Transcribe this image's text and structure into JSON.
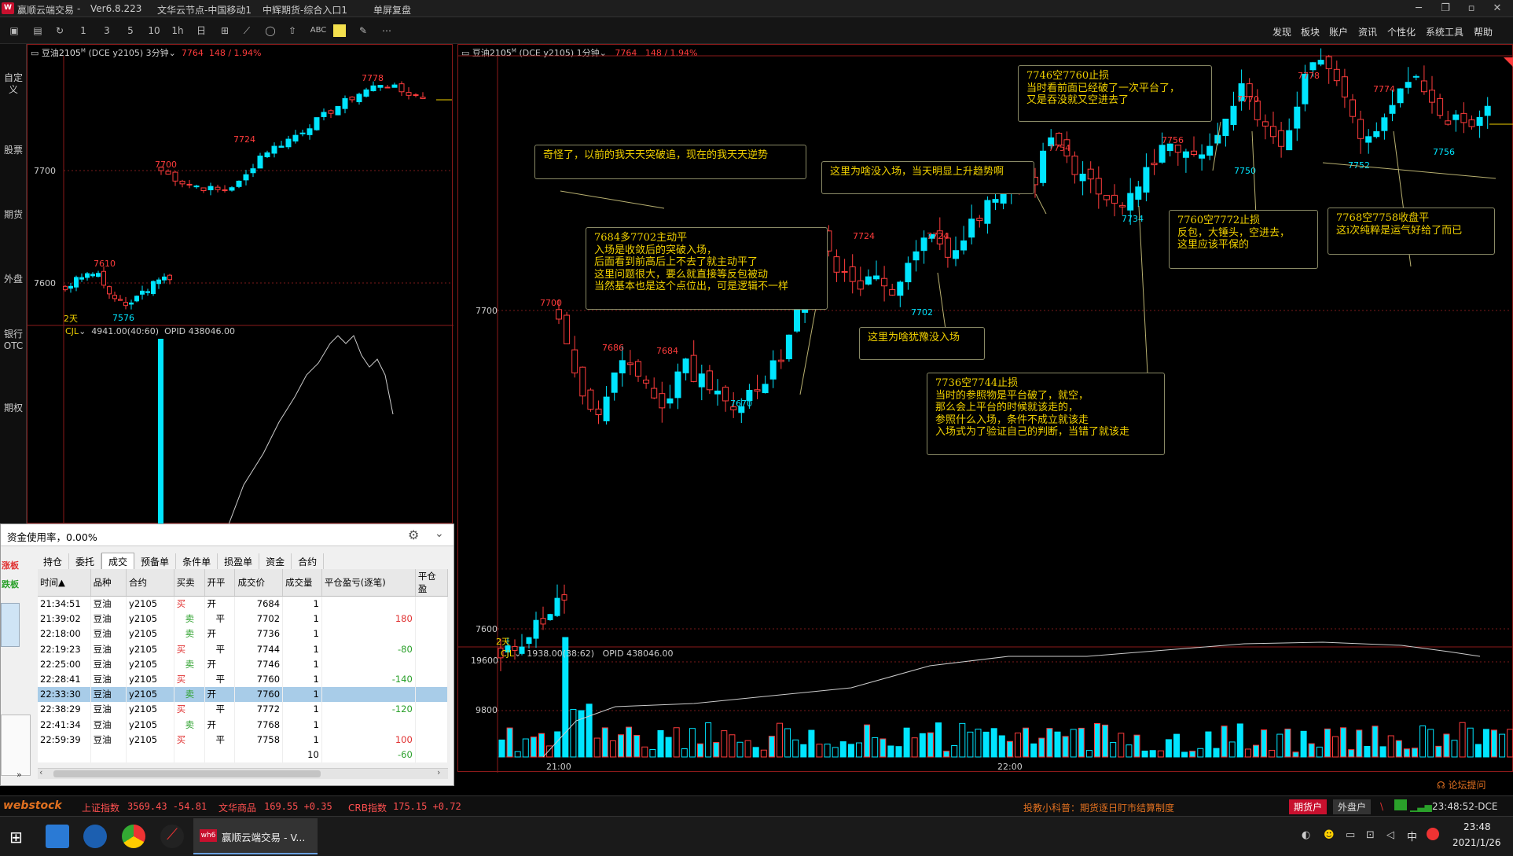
{
  "app": {
    "title": "赢顺云端交易",
    "version": "Ver6.8.223",
    "node": "文华云节点-中国移动1",
    "broker": "中辉期货-综合入口1",
    "mode": "单屏复盘",
    "win_controls": [
      "─",
      "❐",
      "▫",
      "✕"
    ]
  },
  "toolbar": {
    "periods": [
      "1",
      "3",
      "5",
      "10",
      "1h",
      "日"
    ],
    "menus": [
      "发现",
      "板块",
      "账户",
      "资讯",
      "个性化",
      "系统工具",
      "帮助"
    ]
  },
  "sidetabs": [
    "自定义",
    "股票",
    "期货",
    "外盘",
    "银行OTC",
    "期权"
  ],
  "left_chart": {
    "symbol": "豆油2105",
    "sup": "M",
    "code": "(DCE y2105)",
    "period": "3分钟",
    "price": "7764",
    "change": "148 / 1.94%",
    "y_labels": [
      "7700",
      "7600"
    ],
    "marks": [
      "7778",
      "7724",
      "7700",
      "7610",
      "7576"
    ],
    "days": "2天",
    "vol_label": "CJL",
    "vol_value": "4941.00(40:60)",
    "opi": "OPID 438046.00"
  },
  "main_chart": {
    "symbol": "豆油2105",
    "sup": "M",
    "code": "(DCE y2105)",
    "period": "1分钟",
    "price": "7764",
    "change": "148 / 1.94%",
    "y_labels": [
      "7700",
      "7600"
    ],
    "marks": [
      "7700",
      "7686",
      "7684",
      "7670",
      "7724",
      "7724",
      "7702",
      "7754",
      "7734",
      "7756",
      "7770",
      "7750",
      "7778",
      "7752",
      "7774",
      "7756"
    ],
    "days": "2天",
    "vol_label": "CJL",
    "vol_value": "1938.00(38:62)",
    "opi": "OPID 438046.00",
    "vol_y": [
      "19600",
      "9800"
    ],
    "x_labels": [
      "21:00",
      "22:00"
    ]
  },
  "notes": [
    "奇怪了，以前的我天天突破追，现在的我天天逆势",
    "7684多7702主动平\n入场是收敛后的突破入场，\n后面看到前高后上不去了就主动平了\n这里问题很大，要么就直接等反包被动\n当然基本也是这个点位出，可是逻辑不一样",
    "这里为啥没入场，当天明显上升趋势啊",
    "这里为啥犹豫没入场",
    "7746空7760止损\n当时看前面已经破了一次平台了，\n又是吞没就又空进去了",
    "7736空7744止损\n当时的参照物是平台破了，就空，\n那么会上平台的时候就该走的，\n参照什么入场，条件不成立就该走\n入场式为了验证自己的判断，当错了就该走",
    "7760空7772止损\n反包，大锤头，空进去，\n这里应该平保的",
    "7768空7758收盘平\n这i次纯粹是运气好给了而已"
  ],
  "trade_panel": {
    "usage": "资金使用率，0.00%",
    "left_labels": [
      "涨板",
      "跌板"
    ],
    "tabs": [
      "持仓",
      "委托",
      "成交",
      "预备单",
      "条件单",
      "损盈单",
      "资金",
      "合约"
    ],
    "active_tab": "成交",
    "columns": [
      "时间▲",
      "品种",
      "合约",
      "买卖",
      "开平",
      "成交价",
      "成交量",
      "平仓盈亏(逐笔)",
      "平仓盈"
    ],
    "rows": [
      {
        "time": "21:34:51",
        "name": "豆油",
        "contract": "y2105",
        "side": "买",
        "oc": "开",
        "price": "7684",
        "vol": "1",
        "pl": ""
      },
      {
        "time": "21:39:02",
        "name": "豆油",
        "contract": "y2105",
        "side": "卖",
        "oc": "平",
        "price": "7702",
        "vol": "1",
        "pl": "180"
      },
      {
        "time": "22:18:00",
        "name": "豆油",
        "contract": "y2105",
        "side": "卖",
        "oc": "开",
        "price": "7736",
        "vol": "1",
        "pl": ""
      },
      {
        "time": "22:19:23",
        "name": "豆油",
        "contract": "y2105",
        "side": "买",
        "oc": "平",
        "price": "7744",
        "vol": "1",
        "pl": "-80"
      },
      {
        "time": "22:25:00",
        "name": "豆油",
        "contract": "y2105",
        "side": "卖",
        "oc": "开",
        "price": "7746",
        "vol": "1",
        "pl": ""
      },
      {
        "time": "22:28:41",
        "name": "豆油",
        "contract": "y2105",
        "side": "买",
        "oc": "平",
        "price": "7760",
        "vol": "1",
        "pl": "-140"
      },
      {
        "time": "22:33:30",
        "name": "豆油",
        "contract": "y2105",
        "side": "卖",
        "oc": "开",
        "price": "7760",
        "vol": "1",
        "pl": ""
      },
      {
        "time": "22:38:29",
        "name": "豆油",
        "contract": "y2105",
        "side": "买",
        "oc": "平",
        "price": "7772",
        "vol": "1",
        "pl": "-120"
      },
      {
        "time": "22:41:34",
        "name": "豆油",
        "contract": "y2105",
        "side": "卖",
        "oc": "开",
        "price": "7768",
        "vol": "1",
        "pl": ""
      },
      {
        "time": "22:59:39",
        "name": "豆油",
        "contract": "y2105",
        "side": "买",
        "oc": "平",
        "price": "7758",
        "vol": "1",
        "pl": "100"
      }
    ],
    "total_vol": "10",
    "total_pl": "-60"
  },
  "statusbar": {
    "brand": "webstock",
    "idx1_name": "上证指数",
    "idx1": "3569.43  -54.81",
    "idx2_name": "文华商品",
    "idx2": "169.55  +0.35",
    "idx3_name": "CRB指数",
    "idx3": "175.15  +0.72",
    "tip": "投教小科普：期货逐日盯市结算制度",
    "btn_futures": "期货户",
    "btn_foreign": "外盘户",
    "time": "23:48:52-DCE",
    "forum": "论坛提问"
  },
  "taskbar": {
    "app_label": "赢顺云端交易 - V...",
    "clock": "23:48",
    "date": "2021/1/26",
    "ime": "中"
  },
  "colors": {
    "up": "#ff3c3c",
    "down": "#00e5ff",
    "frame": "#8b1a1a",
    "note": "#f0d000"
  }
}
